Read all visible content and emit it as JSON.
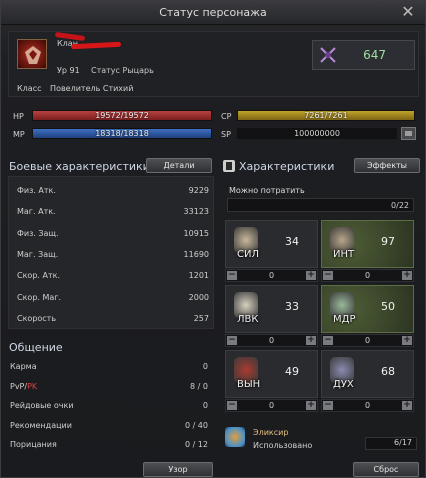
{
  "window": {
    "title": "Статус персонажа"
  },
  "header": {
    "clan_label": "Клан",
    "level_label": "Ур",
    "level_value": "91",
    "status_label": "Статус",
    "status_value": "Рыцарь",
    "class_label": "Класс",
    "class_value": "Повелитель Стихий",
    "points": "647"
  },
  "bars": {
    "hp": {
      "label": "HP",
      "text": "19572/19572",
      "fraction": 1.0
    },
    "mp": {
      "label": "MP",
      "text": "18318/18318",
      "fraction": 1.0
    },
    "cp": {
      "label": "CP",
      "text": "7261/7261",
      "fraction": 1.0
    },
    "sp": {
      "label": "SP",
      "text": "100000000"
    }
  },
  "combat": {
    "title": "Боевые характеристики",
    "details_button": "Детали",
    "stats": [
      {
        "label": "Физ. Атк.",
        "value": "9229"
      },
      {
        "label": "Маг. Атк.",
        "value": "33123"
      },
      {
        "label": "Физ. Защ.",
        "value": "10915"
      },
      {
        "label": "Маг. Защ.",
        "value": "11690"
      },
      {
        "label": "Скор. Атк.",
        "value": "1201"
      },
      {
        "label": "Скор. Маг.",
        "value": "2000"
      },
      {
        "label": "Скорость",
        "value": "257"
      }
    ]
  },
  "social": {
    "title": "Общение",
    "rows": [
      {
        "label": "Карма",
        "value": "0"
      },
      {
        "label": "PvP/",
        "label_pk": "PK",
        "value": "8 / 0"
      },
      {
        "label": "Рейдовые очки",
        "value": "0"
      },
      {
        "label": "Рекомендации",
        "value": "0 / 40"
      },
      {
        "label": "Порицания",
        "value": "0 / 12"
      }
    ],
    "inspect_button": "Узор"
  },
  "characteristics": {
    "title": "Характеристики",
    "effects_button": "Эффекты",
    "spend_label": "Можно потратить",
    "spend_value": "0/22",
    "cells": [
      {
        "abbr": "СИЛ",
        "value": "34",
        "added": "0",
        "icon": "fist-icon"
      },
      {
        "abbr": "ИНТ",
        "value": "97",
        "added": "0",
        "icon": "book-icon"
      },
      {
        "abbr": "ЛВК",
        "value": "33",
        "added": "0",
        "icon": "boot-icon"
      },
      {
        "abbr": "МДР",
        "value": "50",
        "added": "0",
        "icon": "feather-icon"
      },
      {
        "abbr": "ВЫН",
        "value": "49",
        "added": "0",
        "icon": "heart-icon"
      },
      {
        "abbr": "ДУХ",
        "value": "68",
        "added": "0",
        "icon": "spirit-icon"
      }
    ],
    "elixir_name": "Эликсир",
    "elixir_used_label": "Использовано",
    "elixir_count": "6/17",
    "reset_button": "Сброс"
  },
  "colors": {
    "hp": "#b84242",
    "mp": "#3e70c2",
    "cp": "#c2a42a",
    "points": "#9fe09f",
    "pk": "#d84040"
  }
}
